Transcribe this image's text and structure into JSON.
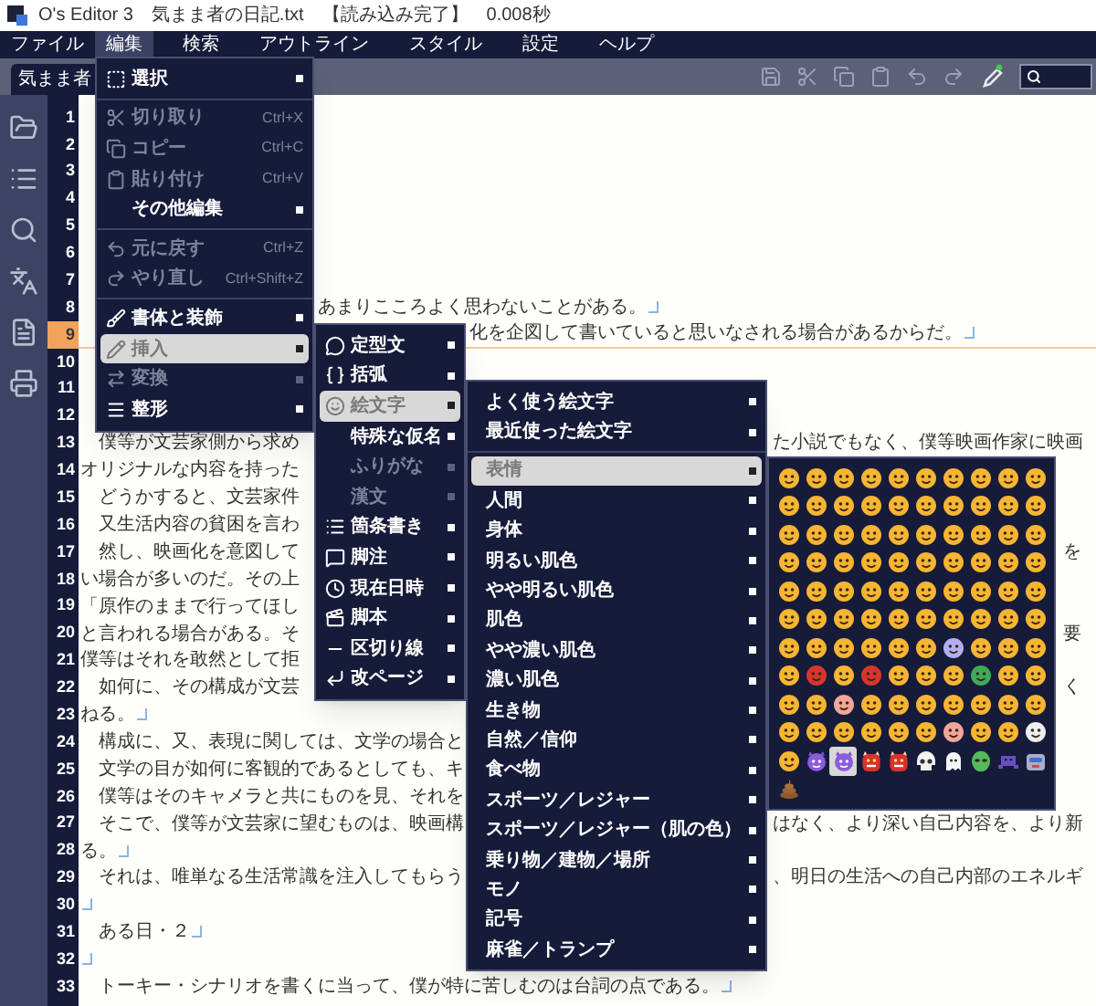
{
  "window": {
    "title": "O's Editor 3　気まま者の日記.txt　【読み込み完了】　0.008秒"
  },
  "menu_bar": [
    {
      "label": "ファイル",
      "selected": false
    },
    {
      "label": "編集",
      "selected": true
    },
    {
      "label": "検索",
      "selected": false
    },
    {
      "label": "アウトライン",
      "selected": false
    },
    {
      "label": "スタイル",
      "selected": false
    },
    {
      "label": "設定",
      "selected": false
    },
    {
      "label": "ヘルプ",
      "selected": false
    }
  ],
  "tabs": [
    {
      "label": "気まま者",
      "selected": true
    }
  ],
  "editor": {
    "lines": [
      {
        "number": "1",
        "current": false,
        "eol": false
      },
      {
        "number": "2",
        "current": false,
        "eol": false
      },
      {
        "number": "3",
        "current": false,
        "eol": false
      },
      {
        "number": "4",
        "current": false,
        "eol": false
      },
      {
        "number": "5",
        "current": false,
        "eol": false
      },
      {
        "number": "6",
        "current": false,
        "eol": false
      },
      {
        "number": "7",
        "current": false,
        "eol": false
      },
      {
        "number": "8",
        "current": false,
        "right": "あまりこころよく思わないことがある。",
        "eol": true
      },
      {
        "number": "9",
        "current": true,
        "right": "化を企図して書いていると思いなされる場合があるからだ。",
        "eol": true
      },
      {
        "number": "10",
        "current": false,
        "eol": false
      },
      {
        "number": "11",
        "current": false,
        "eol": false
      },
      {
        "number": "12",
        "current": false,
        "eol": false
      },
      {
        "number": "13",
        "current": false,
        "text": "　僕等が文芸家側から求め",
        "right": "た小説でもなく、僕等映画作家に映画",
        "eol": false
      },
      {
        "number": "14",
        "current": false,
        "text": "オリジナルな内容を持った",
        "eol": false
      },
      {
        "number": "15",
        "current": false,
        "text": "　どうかすると、文芸家件",
        "eol": false
      },
      {
        "number": "16",
        "current": false,
        "text": "　又生活内容の貧困を言わ",
        "eol": false
      },
      {
        "number": "17",
        "current": false,
        "text": "　然し、映画化を意図して",
        "right": "を",
        "eol": false
      },
      {
        "number": "18",
        "current": false,
        "text": "い場合が多いのだ。その上",
        "eol": false
      },
      {
        "number": "19",
        "current": false,
        "text": "「原作のままで行ってほし",
        "eol": false
      },
      {
        "number": "20",
        "current": false,
        "text": "と言われる場合がある。そ",
        "right": "要",
        "eol": false
      },
      {
        "number": "21",
        "current": false,
        "text": "僕等はそれを敢然として拒",
        "eol": false
      },
      {
        "number": "22",
        "current": false,
        "text": "　如何に、その構成が文芸",
        "right": "く",
        "eol": false
      },
      {
        "number": "23",
        "current": false,
        "text": "ねる。",
        "eol": true
      },
      {
        "number": "24",
        "current": false,
        "text": "　構成に、又、表現に関しては、文学の場合と"
      },
      {
        "number": "25",
        "current": false,
        "text": "　文学の目が如何に客観的であるとしても、キ"
      },
      {
        "number": "26",
        "current": false,
        "text": "　僕等はそのキャメラと共にものを見、それを"
      },
      {
        "number": "27",
        "current": false,
        "text": "　そこで、僕等が文芸家に望むものは、映画構",
        "right": "はなく、より深い自己内容を、より新",
        "eol": false
      },
      {
        "number": "28",
        "current": false,
        "text": "る。",
        "eol": true
      },
      {
        "number": "29",
        "current": false,
        "text": "　それは、唯単なる生活常識を注入してもらう",
        "right": "、明日の生活への自己内部のエネルギ",
        "eol": false
      },
      {
        "number": "30",
        "current": false,
        "eol": true
      },
      {
        "number": "31",
        "current": false,
        "text": "　ある日・２",
        "eol": true
      },
      {
        "number": "32",
        "current": false,
        "eol": true
      },
      {
        "number": "33",
        "current": false,
        "text": "　トーキー・シナリオを書くに当って、僕が特に苦しむのは台詞の点である。",
        "eol": true
      }
    ]
  },
  "edit_menu": {
    "groups": [
      [
        {
          "label": "選択",
          "submenu": true,
          "disabled": false,
          "selected": false
        }
      ],
      [
        {
          "label": "切り取り",
          "shortcut": "Ctrl+X",
          "submenu": false,
          "disabled": true,
          "selected": false
        },
        {
          "label": "コピー",
          "shortcut": "Ctrl+C",
          "submenu": false,
          "disabled": true,
          "selected": false
        },
        {
          "label": "貼り付け",
          "shortcut": "Ctrl+V",
          "submenu": false,
          "disabled": true,
          "selected": false
        },
        {
          "label": "その他編集",
          "submenu": true,
          "disabled": false,
          "selected": false
        }
      ],
      [
        {
          "label": "元に戻す",
          "shortcut": "Ctrl+Z",
          "submenu": false,
          "disabled": true,
          "selected": false
        },
        {
          "label": "やり直し",
          "shortcut": "Ctrl+Shift+Z",
          "submenu": false,
          "disabled": true,
          "selected": false
        }
      ],
      [
        {
          "label": "書体と装飾",
          "submenu": true,
          "disabled": false,
          "selected": false
        },
        {
          "label": "挿入",
          "submenu": true,
          "disabled": false,
          "selected": true
        },
        {
          "label": "変換",
          "submenu": true,
          "disabled": true,
          "selected": false
        },
        {
          "label": "整形",
          "submenu": true,
          "disabled": false,
          "selected": false
        }
      ]
    ]
  },
  "insert_menu": {
    "groups": [
      [
        {
          "label": "定型文",
          "submenu": true,
          "disabled": false,
          "selected": false
        },
        {
          "label": "括弧",
          "submenu": true,
          "disabled": false,
          "selected": false
        },
        {
          "label": "絵文字",
          "submenu": true,
          "disabled": false,
          "selected": true
        },
        {
          "label": "特殊な仮名",
          "submenu": true,
          "disabled": false,
          "selected": false
        },
        {
          "label": "ふりがな",
          "submenu": true,
          "disabled": true,
          "selected": false
        },
        {
          "label": "漢文",
          "submenu": true,
          "disabled": true,
          "selected": false
        },
        {
          "label": "箇条書き",
          "submenu": true,
          "disabled": false,
          "selected": false
        },
        {
          "label": "脚注",
          "submenu": true,
          "disabled": false,
          "selected": false
        },
        {
          "label": "現在日時",
          "submenu": true,
          "disabled": false,
          "selected": false
        },
        {
          "label": "脚本",
          "submenu": true,
          "disabled": false,
          "selected": false
        },
        {
          "label": "区切り線",
          "submenu": true,
          "disabled": false,
          "selected": false
        },
        {
          "label": "改ページ",
          "submenu": true,
          "disabled": false,
          "selected": false
        }
      ]
    ]
  },
  "emoji_menu": {
    "groups": [
      [
        {
          "label": "よく使う絵文字",
          "submenu": true,
          "disabled": false,
          "selected": false
        },
        {
          "label": "最近使った絵文字",
          "submenu": true,
          "disabled": false,
          "selected": false
        }
      ],
      [
        {
          "label": "表情",
          "submenu": true,
          "disabled": false,
          "selected": true
        },
        {
          "label": "人間",
          "submenu": true,
          "disabled": false,
          "selected": false
        },
        {
          "label": "身体",
          "submenu": true,
          "disabled": false,
          "selected": false
        },
        {
          "label": "明るい肌色",
          "submenu": true,
          "disabled": false,
          "selected": false
        },
        {
          "label": "やや明るい肌色",
          "submenu": true,
          "disabled": false,
          "selected": false
        },
        {
          "label": "肌色",
          "submenu": true,
          "disabled": false,
          "selected": false
        },
        {
          "label": "やや濃い肌色",
          "submenu": true,
          "disabled": false,
          "selected": false
        },
        {
          "label": "濃い肌色",
          "submenu": true,
          "disabled": false,
          "selected": false
        },
        {
          "label": "生き物",
          "submenu": true,
          "disabled": false,
          "selected": false
        },
        {
          "label": "自然／信仰",
          "submenu": true,
          "disabled": false,
          "selected": false
        },
        {
          "label": "食べ物",
          "submenu": true,
          "disabled": false,
          "selected": false
        },
        {
          "label": "スポーツ／レジャー",
          "submenu": true,
          "disabled": false,
          "selected": false
        },
        {
          "label": "スポーツ／レジャー（肌の色）",
          "submenu": true,
          "disabled": false,
          "selected": false
        },
        {
          "label": "乗り物／建物／場所",
          "submenu": true,
          "disabled": false,
          "selected": false
        },
        {
          "label": "モノ",
          "submenu": true,
          "disabled": false,
          "selected": false
        },
        {
          "label": "記号",
          "submenu": true,
          "disabled": false,
          "selected": false
        },
        {
          "label": "麻雀／トランプ",
          "submenu": true,
          "disabled": false,
          "selected": false
        }
      ]
    ]
  },
  "emoji_grid": [
    [
      {
        "kind": "face",
        "selected": false
      },
      {
        "kind": "face",
        "selected": false
      },
      {
        "kind": "face",
        "selected": false
      },
      {
        "kind": "face",
        "selected": false
      },
      {
        "kind": "face",
        "selected": false
      },
      {
        "kind": "face",
        "selected": false
      },
      {
        "kind": "face",
        "selected": false
      },
      {
        "kind": "face",
        "selected": false
      },
      {
        "kind": "face",
        "selected": false
      },
      {
        "kind": "face",
        "selected": false
      }
    ],
    [
      {
        "kind": "face",
        "selected": false
      },
      {
        "kind": "face",
        "selected": false
      },
      {
        "kind": "face",
        "selected": false
      },
      {
        "kind": "face",
        "selected": false
      },
      {
        "kind": "face",
        "selected": false
      },
      {
        "kind": "face",
        "selected": false
      },
      {
        "kind": "face",
        "selected": false
      },
      {
        "kind": "face",
        "selected": false
      },
      {
        "kind": "face",
        "selected": false
      },
      {
        "kind": "face",
        "selected": false
      }
    ],
    [
      {
        "kind": "face",
        "selected": false
      },
      {
        "kind": "face",
        "selected": false
      },
      {
        "kind": "face",
        "selected": false
      },
      {
        "kind": "face",
        "selected": false
      },
      {
        "kind": "face",
        "selected": false
      },
      {
        "kind": "face",
        "selected": false
      },
      {
        "kind": "face",
        "selected": false
      },
      {
        "kind": "face",
        "selected": false
      },
      {
        "kind": "face",
        "selected": false
      },
      {
        "kind": "face",
        "selected": false
      }
    ],
    [
      {
        "kind": "face",
        "selected": false
      },
      {
        "kind": "face",
        "selected": false
      },
      {
        "kind": "face",
        "selected": false
      },
      {
        "kind": "face",
        "selected": false
      },
      {
        "kind": "face",
        "selected": false
      },
      {
        "kind": "face",
        "selected": false
      },
      {
        "kind": "face",
        "selected": false
      },
      {
        "kind": "face",
        "selected": false
      },
      {
        "kind": "face",
        "selected": false
      },
      {
        "kind": "face",
        "selected": false
      }
    ],
    [
      {
        "kind": "face",
        "selected": false
      },
      {
        "kind": "face",
        "selected": false
      },
      {
        "kind": "face",
        "selected": false
      },
      {
        "kind": "face",
        "selected": false
      },
      {
        "kind": "face",
        "selected": false
      },
      {
        "kind": "face",
        "selected": false
      },
      {
        "kind": "face",
        "selected": false
      },
      {
        "kind": "face",
        "selected": false
      },
      {
        "kind": "face",
        "selected": false
      },
      {
        "kind": "face",
        "selected": false
      }
    ],
    [
      {
        "kind": "face",
        "selected": false
      },
      {
        "kind": "face",
        "selected": false
      },
      {
        "kind": "face",
        "selected": false
      },
      {
        "kind": "face",
        "selected": false
      },
      {
        "kind": "face",
        "selected": false
      },
      {
        "kind": "face",
        "selected": false
      },
      {
        "kind": "face",
        "selected": false
      },
      {
        "kind": "face",
        "selected": false
      },
      {
        "kind": "face",
        "selected": false
      },
      {
        "kind": "face",
        "selected": false
      }
    ],
    [
      {
        "kind": "face",
        "selected": false
      },
      {
        "kind": "face",
        "selected": false
      },
      {
        "kind": "face",
        "selected": false
      },
      {
        "kind": "face",
        "selected": false
      },
      {
        "kind": "face",
        "selected": false
      },
      {
        "kind": "face",
        "selected": false
      },
      {
        "kind": "cold-face",
        "selected": false
      },
      {
        "kind": "face",
        "selected": false
      },
      {
        "kind": "face",
        "selected": false
      },
      {
        "kind": "face",
        "selected": false
      }
    ],
    [
      {
        "kind": "face",
        "selected": false
      },
      {
        "kind": "angry-face",
        "selected": false
      },
      {
        "kind": "face",
        "selected": false
      },
      {
        "kind": "angry-face",
        "selected": false
      },
      {
        "kind": "face",
        "selected": false
      },
      {
        "kind": "face",
        "selected": false
      },
      {
        "kind": "face",
        "selected": false
      },
      {
        "kind": "sick-face",
        "selected": false
      },
      {
        "kind": "face",
        "selected": false
      },
      {
        "kind": "face",
        "selected": false
      }
    ],
    [
      {
        "kind": "face",
        "selected": false
      },
      {
        "kind": "face",
        "selected": false
      },
      {
        "kind": "pink-face",
        "selected": false
      },
      {
        "kind": "face",
        "selected": false
      },
      {
        "kind": "face",
        "selected": false
      },
      {
        "kind": "face",
        "selected": false
      },
      {
        "kind": "face",
        "selected": false
      },
      {
        "kind": "face",
        "selected": false
      },
      {
        "kind": "face",
        "selected": false
      },
      {
        "kind": "face",
        "selected": false
      }
    ],
    [
      {
        "kind": "face",
        "selected": false
      },
      {
        "kind": "face",
        "selected": false
      },
      {
        "kind": "face",
        "selected": false
      },
      {
        "kind": "face",
        "selected": false
      },
      {
        "kind": "face",
        "selected": false
      },
      {
        "kind": "face",
        "selected": false
      },
      {
        "kind": "pink-face",
        "selected": false
      },
      {
        "kind": "face",
        "selected": false
      },
      {
        "kind": "face",
        "selected": false
      },
      {
        "kind": "clown-face",
        "selected": false
      }
    ],
    [
      {
        "kind": "face",
        "selected": false
      },
      {
        "kind": "devil",
        "selected": false
      },
      {
        "kind": "devil",
        "selected": true
      },
      {
        "kind": "ogre",
        "selected": false
      },
      {
        "kind": "ogre",
        "selected": false
      },
      {
        "kind": "skull",
        "selected": false
      },
      {
        "kind": "ghost",
        "selected": false
      },
      {
        "kind": "alien",
        "selected": false
      },
      {
        "kind": "invader",
        "selected": false
      },
      {
        "kind": "robot",
        "selected": false
      }
    ],
    [
      {
        "kind": "poop",
        "selected": false
      }
    ]
  ]
}
